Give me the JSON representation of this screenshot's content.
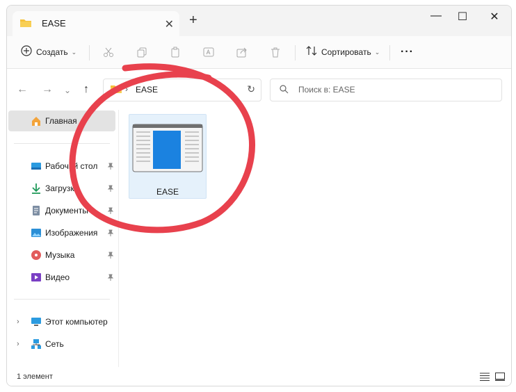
{
  "tab": {
    "title": "EASE",
    "close": "✕",
    "new": "+"
  },
  "window_controls": {
    "minimize": "—",
    "maximize": "☐",
    "close": "✕"
  },
  "toolbar": {
    "create_label": "Создать",
    "sort_label": "Сортировать",
    "more": "···"
  },
  "address": {
    "separator": "›",
    "path": "EASE",
    "search_placeholder": "Поиск в: EASE"
  },
  "sidebar": {
    "home": "Главная",
    "items": [
      {
        "label": "Рабочий стол"
      },
      {
        "label": "Загрузки"
      },
      {
        "label": "Документы"
      },
      {
        "label": "Изображения"
      },
      {
        "label": "Музыка"
      },
      {
        "label": "Видео"
      }
    ],
    "computer": "Этот компьютер",
    "network": "Сеть"
  },
  "content": {
    "files": [
      {
        "name": "EASE"
      }
    ]
  },
  "status": {
    "count": "1 элемент"
  },
  "colors": {
    "accent_circle": "#e8414d",
    "selection": "#e5f1fb",
    "folder": "#f5c13b"
  }
}
